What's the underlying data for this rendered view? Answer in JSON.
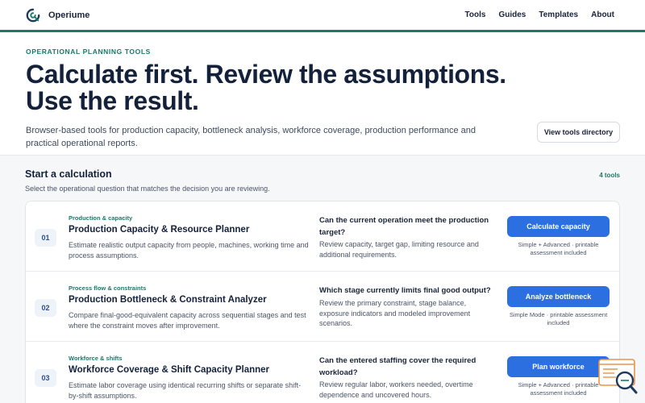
{
  "nav": {
    "brand": "Operiume",
    "links": [
      "Tools",
      "Guides",
      "Templates",
      "About"
    ]
  },
  "hero": {
    "eyebrow": "OPERATIONAL PLANNING TOOLS",
    "title_line1": "Calculate first. Review the assumptions.",
    "title_line2": "Use the result.",
    "description": "Browser-based tools for production capacity, bottleneck analysis, workforce coverage, production performance and practical operational reports.",
    "directory_button": "View tools directory"
  },
  "section": {
    "title": "Start a calculation",
    "count": "4 tools",
    "subtitle": "Select the operational question that matches the decision you are reviewing."
  },
  "tools": [
    {
      "number": "01",
      "category": "Production & capacity",
      "title": "Production Capacity & Resource Planner",
      "description": "Estimate realistic output capacity from people, machines, working time and process assumptions.",
      "question": "Can the current operation meet the production target?",
      "question_detail": "Review capacity, target gap, limiting resource and additional requirements.",
      "button": "Calculate capacity",
      "note": "Simple + Advanced · printable assessment included"
    },
    {
      "number": "02",
      "category": "Process flow & constraints",
      "title": "Production Bottleneck & Constraint Analyzer",
      "description": "Compare final-good-equivalent capacity across sequential stages and test where the constraint moves after improvement.",
      "question": "Which stage currently limits final good output?",
      "question_detail": "Review the primary constraint, stage balance, exposure indicators and modeled improvement scenarios.",
      "button": "Analyze bottleneck",
      "note": "Simple Mode · printable assessment included"
    },
    {
      "number": "03",
      "category": "Workforce & shifts",
      "title": "Workforce Coverage & Shift Capacity Planner",
      "description": "Estimate labor coverage using identical recurring shifts or separate shift-by-shift assumptions.",
      "question": "Can the entered staffing cover the required workload?",
      "question_detail": "Review regular labor, workers needed, overtime dependence and uncovered hours.",
      "button": "Plan workforce",
      "note": "Simple + Advanced · printable assessment included"
    }
  ]
}
